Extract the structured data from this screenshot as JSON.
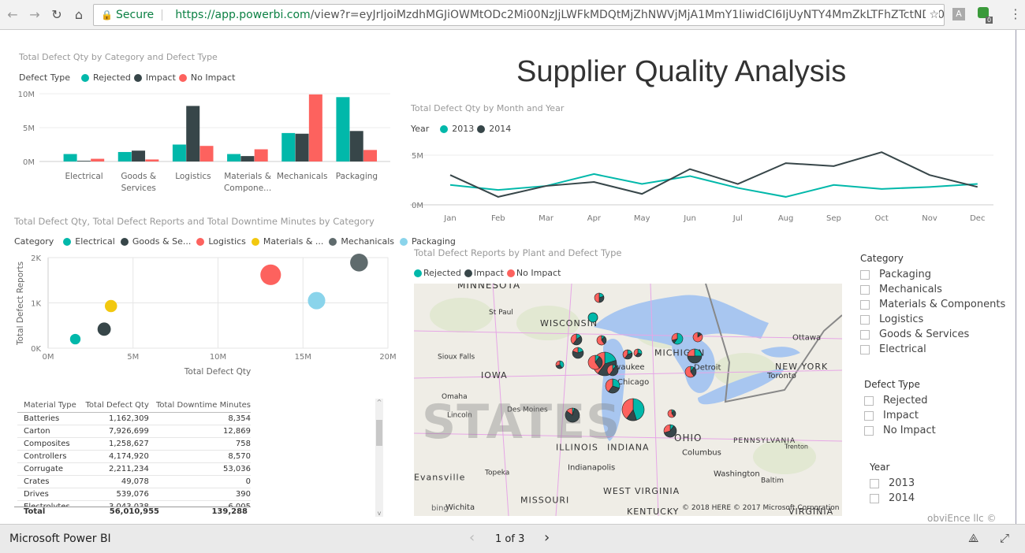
{
  "browser": {
    "secure_label": "Secure",
    "url_host": "https://app.powerbi.com",
    "url_path": "/view?r=eyJrIjoiMzdhMGJiOWMtODc2Mi00NzJjLWFkMDQtMjZhNWVjMjA1MmY1IiwidCI6IjUyNTY4MmZkLTFhZTctNDg0Ny04Mjc1LT",
    "icons": [
      "back-icon",
      "forward-icon",
      "reload-icon",
      "home-icon",
      "lock-icon",
      "star-icon",
      "extension-icon",
      "menu-icon"
    ],
    "ext_badge": "0",
    "ext_a": "A"
  },
  "report_title": "Supplier Quality Analysis",
  "colors": {
    "rejected": "#01B8AA",
    "impact": "#374649",
    "no_impact": "#FD625E",
    "materials": "#F2C80F",
    "mechanicals": "#5F6B6D",
    "packaging": "#8AD4EB"
  },
  "bar_chart": {
    "chart_data": {
      "type": "bar",
      "title": "Total Defect Qty by Category and Defect Type",
      "legend_title": "Defect Type",
      "categories": [
        "Electrical",
        "Goods & Services",
        "Logistics",
        "Materials & Compone...",
        "Mechanicals",
        "Packaging"
      ],
      "category_lines": [
        [
          "Electrical"
        ],
        [
          "Goods &",
          "Services"
        ],
        [
          "Logistics"
        ],
        [
          "Materials &",
          "Compone..."
        ],
        [
          "Mechanicals"
        ],
        [
          "Packaging"
        ]
      ],
      "series": [
        {
          "name": "Rejected",
          "values": [
            1100000,
            1400000,
            2500000,
            1100000,
            4200000,
            9500000
          ]
        },
        {
          "name": "Impact",
          "values": [
            100000,
            1600000,
            8200000,
            800000,
            4100000,
            4500000
          ]
        },
        {
          "name": "No Impact",
          "values": [
            400000,
            300000,
            2300000,
            1800000,
            9900000,
            1700000
          ]
        }
      ],
      "yticks": [
        "0M",
        "5M",
        "10M"
      ],
      "ylim": [
        0,
        10000000
      ],
      "grid": true,
      "legend": "top-left"
    }
  },
  "line_chart": {
    "chart_data": {
      "type": "line",
      "title": "Total Defect Qty by Month and Year",
      "legend_title": "Year",
      "categories": [
        "Jan",
        "Feb",
        "Mar",
        "Apr",
        "May",
        "Jun",
        "Jul",
        "Aug",
        "Sep",
        "Oct",
        "Nov",
        "Dec"
      ],
      "series": [
        {
          "name": "2013",
          "values": [
            2000000,
            1500000,
            1900000,
            3100000,
            2100000,
            2900000,
            1700000,
            800000,
            2000000,
            1600000,
            1800000,
            2100000
          ]
        },
        {
          "name": "2014",
          "values": [
            3000000,
            800000,
            1900000,
            2300000,
            1100000,
            3600000,
            2100000,
            4200000,
            3900000,
            5300000,
            3000000,
            1800000
          ]
        }
      ],
      "yticks": [
        "0M",
        "5M"
      ],
      "ylim": [
        0,
        6000000
      ],
      "grid": true,
      "legend": "top-left"
    }
  },
  "scatter_chart": {
    "chart_data": {
      "type": "scatter",
      "title": "Total Defect Qty, Total Defect Reports and Total Downtime Minutes by Category",
      "legend_title": "Category",
      "legend_labels": [
        "Electrical",
        "Goods & Se...",
        "Logistics",
        "Materials & ...",
        "Mechanicals",
        "Packaging"
      ],
      "points": [
        {
          "category": "Electrical",
          "x": 1600000,
          "y": 200,
          "size": 5000
        },
        {
          "category": "Goods & Services",
          "x": 3300000,
          "y": 420,
          "size": 12000
        },
        {
          "category": "Logistics",
          "x": 13100000,
          "y": 1620,
          "size": 45000
        },
        {
          "category": "Materials & Components",
          "x": 3700000,
          "y": 930,
          "size": 9000
        },
        {
          "category": "Mechanicals",
          "x": 18300000,
          "y": 1890,
          "size": 30000
        },
        {
          "category": "Packaging",
          "x": 15800000,
          "y": 1050,
          "size": 28000
        }
      ],
      "xlabel": "Total Defect Qty",
      "ylabel": "Total Defect Reports",
      "xticks": [
        "0M",
        "5M",
        "10M",
        "15M",
        "20M"
      ],
      "yticks": [
        "0K",
        "1K",
        "2K"
      ],
      "xlim": [
        0,
        20000000
      ],
      "ylim": [
        0,
        2000
      ],
      "grid": true,
      "legend": "top-left"
    }
  },
  "table": {
    "columns": [
      "Material Type",
      "Total Defect Qty",
      "Total Downtime Minutes"
    ],
    "rows": [
      [
        "Batteries",
        "1,162,309",
        "8,354"
      ],
      [
        "Carton",
        "7,926,699",
        "12,869"
      ],
      [
        "Composites",
        "1,258,627",
        "758"
      ],
      [
        "Controllers",
        "4,174,920",
        "8,570"
      ],
      [
        "Corrugate",
        "2,211,234",
        "53,036"
      ],
      [
        "Crates",
        "49,078",
        "0"
      ],
      [
        "Drives",
        "539,076",
        "390"
      ],
      [
        "Electrolytes",
        "3,043,038",
        "6,005"
      ]
    ],
    "total": [
      "Total",
      "56,010,955",
      "139,288"
    ]
  },
  "map": {
    "title": "Total Defect Reports by Plant and Defect Type",
    "legend": [
      "Rejected",
      "Impact",
      "No Impact"
    ],
    "labels": [
      "MINNESOTA",
      "St Paul",
      "WISCONSIN",
      "Sioux Falls",
      "MICHIGAN",
      "Milwaukee",
      "Chicago",
      "Detroit",
      "Ottawa",
      "Toronto",
      "NEW YORK",
      "IOWA",
      "Omaha",
      "Des Moines",
      "Lincoln",
      "ILLINOIS",
      "INDIANA",
      "OHIO",
      "Columbus",
      "PENNSYLVANIA",
      "Trenton",
      "Indianapolis",
      "Topeka",
      "Washington",
      "Baltim",
      "Evansville",
      "WEST VIRGINIA",
      "MISSOURI",
      "Wichita",
      "KENTUCKY",
      "VIRGINIA",
      "NSAS",
      "STATES"
    ],
    "attribution": "© 2018 HERE   © 2017 Microsoft Corporation",
    "bing": "bing"
  },
  "slicers": [
    {
      "title": "Category",
      "items": [
        "Packaging",
        "Mechanicals",
        "Materials & Components",
        "Logistics",
        "Goods & Services",
        "Electrical"
      ]
    },
    {
      "title": "Defect Type",
      "items": [
        "Rejected",
        "Impact",
        "No Impact"
      ]
    },
    {
      "title": "Year",
      "items": [
        "2013",
        "2014"
      ]
    }
  ],
  "copyright": "obviEnce llc ©",
  "footer": {
    "brand": "Microsoft Power BI",
    "page": "1 of 3"
  }
}
